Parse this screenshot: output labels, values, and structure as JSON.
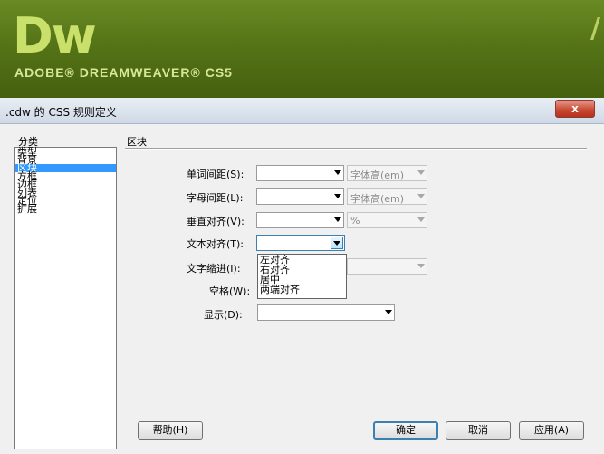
{
  "banner": {
    "logo": "Dw",
    "product": "ADOBE® DREAMWEAVER® CS5",
    "corner_mark": "/"
  },
  "dialog": {
    "title": ".cdw 的 CSS 规则定义",
    "close": "x",
    "category_label": "分类",
    "categories": [
      "类型",
      "背景",
      "区块",
      "方框",
      "边框",
      "列表",
      "定位",
      "扩展"
    ],
    "selected_category": "区块",
    "section_title": "区块",
    "fields": {
      "word_spacing": {
        "label": "单词间距(S):",
        "value": "",
        "unit": "字体高(em)"
      },
      "letter_spacing": {
        "label": "字母间距(L):",
        "value": "",
        "unit": "字体高(em)"
      },
      "vertical_align": {
        "label": "垂直对齐(V):",
        "value": "",
        "unit": "%"
      },
      "text_align": {
        "label": "文本对齐(T):",
        "value": "",
        "options": [
          "左对齐",
          "右对齐",
          "居中",
          "两端对齐"
        ]
      },
      "text_indent": {
        "label": "文字缩进(I):"
      },
      "white_space": {
        "label": "空格(W):"
      },
      "display": {
        "label": "显示(D):",
        "value": ""
      }
    },
    "buttons": {
      "help": "帮助(H)",
      "ok": "确定",
      "cancel": "取消",
      "apply": "应用(A)"
    }
  }
}
